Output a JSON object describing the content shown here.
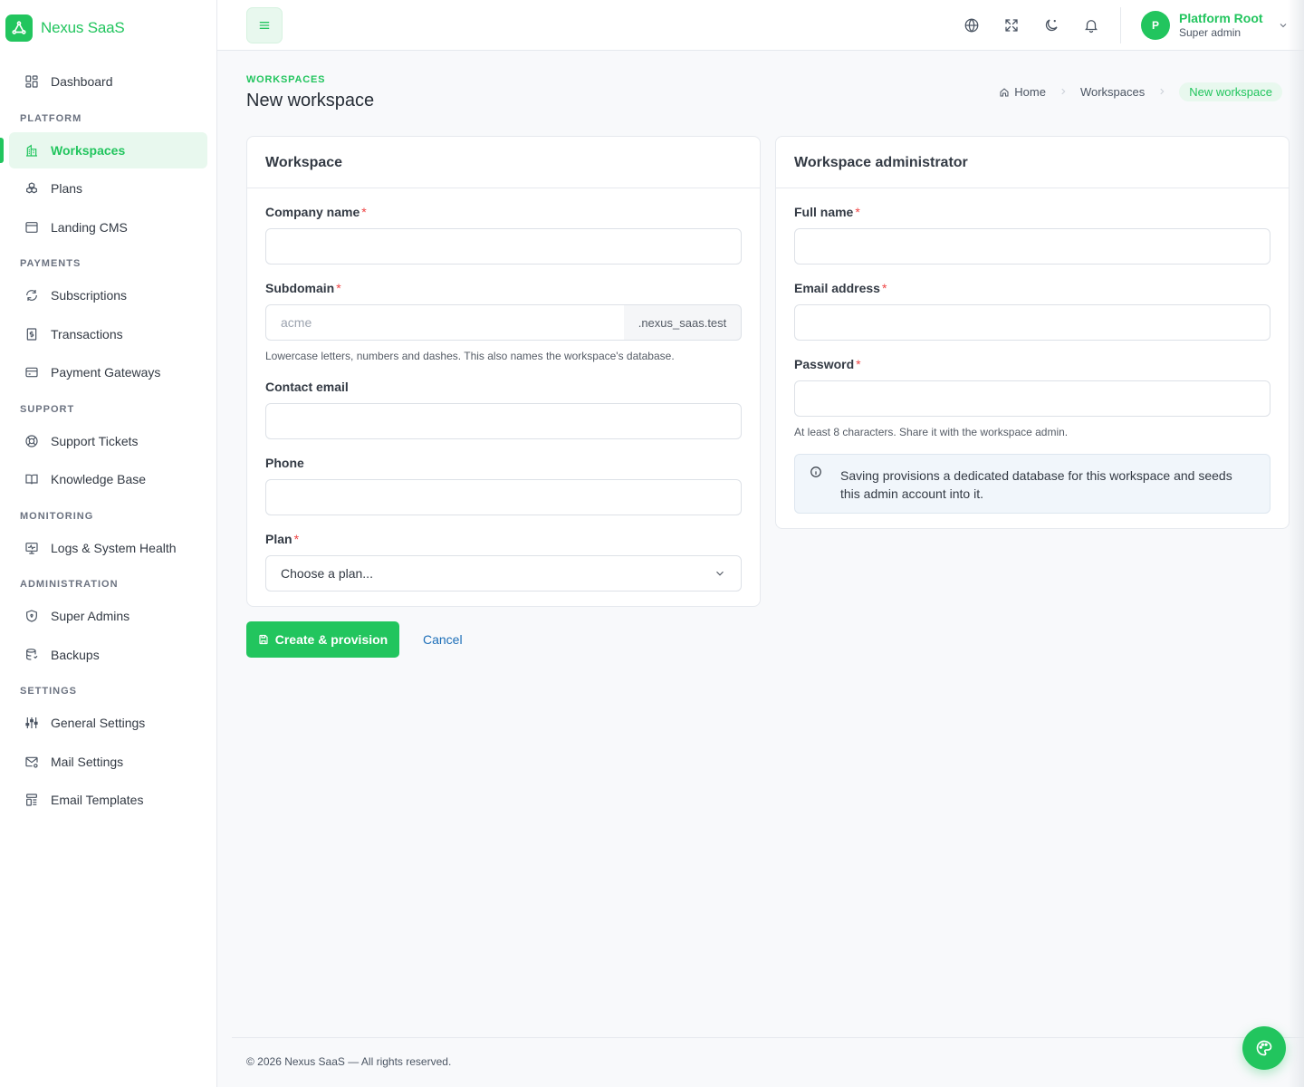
{
  "app": {
    "name": "Nexus SaaS"
  },
  "sidebar": {
    "dashboard": "Dashboard",
    "sections": {
      "platform": "PLATFORM",
      "payments": "PAYMENTS",
      "support": "SUPPORT",
      "monitoring": "MONITORING",
      "administration": "ADMINISTRATION",
      "settings": "SETTINGS"
    },
    "items": {
      "workspaces": "Workspaces",
      "plans": "Plans",
      "landing_cms": "Landing CMS",
      "subscriptions": "Subscriptions",
      "transactions": "Transactions",
      "payment_gateways": "Payment Gateways",
      "support_tickets": "Support Tickets",
      "knowledge_base": "Knowledge Base",
      "logs": "Logs & System Health",
      "super_admins": "Super Admins",
      "backups": "Backups",
      "general_settings": "General Settings",
      "mail_settings": "Mail Settings",
      "email_templates": "Email Templates"
    }
  },
  "user": {
    "initial": "P",
    "name": "Platform Root",
    "role": "Super admin"
  },
  "page": {
    "kicker": "WORKSPACES",
    "title": "New workspace",
    "breadcrumb": [
      "Home",
      "Workspaces",
      "New workspace"
    ]
  },
  "workspace_card": {
    "title": "Workspace",
    "company_name": {
      "label": "Company name",
      "value": ""
    },
    "subdomain": {
      "label": "Subdomain",
      "placeholder": "acme",
      "suffix": ".nexus_saas.test",
      "help": "Lowercase letters, numbers and dashes. This also names the workspace's database."
    },
    "contact_email": {
      "label": "Contact email",
      "value": ""
    },
    "phone": {
      "label": "Phone",
      "value": ""
    },
    "plan": {
      "label": "Plan",
      "selected": "Choose a plan..."
    }
  },
  "admin_card": {
    "title": "Workspace administrator",
    "full_name": {
      "label": "Full name",
      "value": ""
    },
    "email": {
      "label": "Email address",
      "value": ""
    },
    "password": {
      "label": "Password",
      "value": "",
      "help": "At least 8 characters. Share it with the workspace admin."
    },
    "alert": "Saving provisions a dedicated database for this workspace and seeds this admin account into it."
  },
  "actions": {
    "submit": "Create & provision",
    "cancel": "Cancel"
  },
  "footer": {
    "text": "© 2026 Nexus SaaS — All rights reserved."
  },
  "required_mark": "*",
  "colors": {
    "accent": "#22c55e",
    "link": "#1d6fb8",
    "required": "#ef4444"
  }
}
